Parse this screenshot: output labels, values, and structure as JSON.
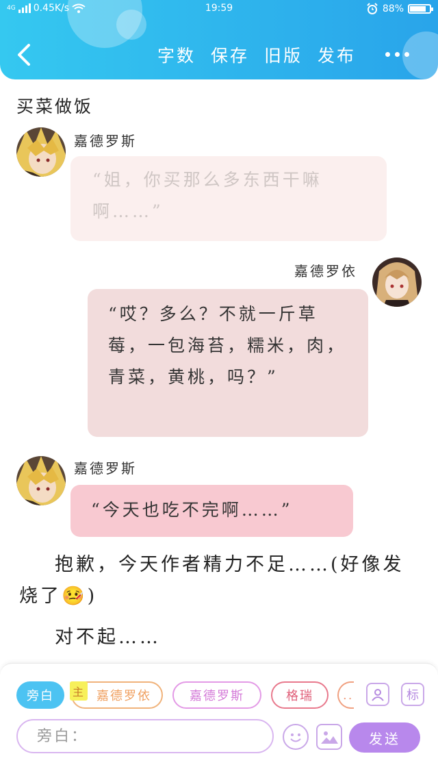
{
  "status_bar": {
    "network": "4G",
    "speed": "0.45K/s",
    "time": "19:59",
    "battery": "88%",
    "battery_level": 0.88
  },
  "header": {
    "actions": [
      "字数",
      "保存",
      "旧版",
      "发布"
    ],
    "colors": {
      "start": "#35c8f0",
      "end": "#29a4ea"
    }
  },
  "story_title": "买菜做饭",
  "messages": [
    {
      "speaker": "嘉德罗斯",
      "side": "left",
      "text": "“姐，你买那么多东西干嘛啊……”"
    },
    {
      "speaker": "嘉德罗依",
      "side": "right",
      "text": "“哎？多么？不就一斤草莓，一包海苔，糯米，肉，青菜，黄桃，吗？”"
    },
    {
      "speaker": "嘉德罗斯",
      "side": "left",
      "text": "“今天也吃不完啊……”"
    }
  ],
  "narration": [
    "抱歉，今天作者精力不足……(好像发烧了🤒)",
    "对不起……"
  ],
  "composer": {
    "roles": [
      {
        "label": "旁白",
        "active": true
      },
      {
        "label": "嘉德罗依",
        "badge": "主"
      },
      {
        "label": "嘉德罗斯"
      },
      {
        "label": "格瑞"
      },
      {
        "label": "..."
      }
    ],
    "input_placeholder": "旁白：",
    "send_label": "发送",
    "mark_label": "标",
    "icons": [
      "character-icon",
      "mark-icon",
      "emoji-icon",
      "image-icon"
    ]
  },
  "colors": {
    "accent": "#b888ec",
    "bubble_faded": "#fbefee",
    "bubble_rose": "#f2dcdc",
    "bubble_pink": "#f8c9d1"
  }
}
